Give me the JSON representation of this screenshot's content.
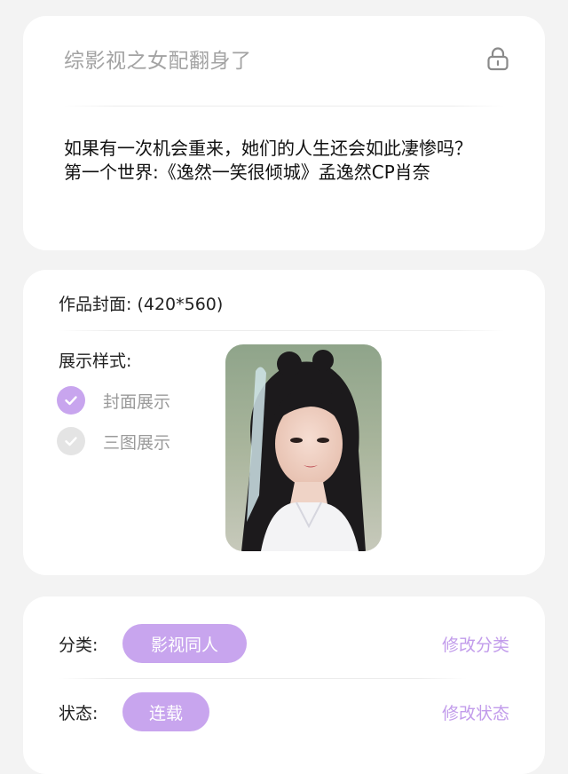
{
  "header": {
    "title": "综影视之女配翻身了"
  },
  "summary": {
    "text": "如果有一次机会重来，她们的人生还会如此凄惨吗？\n第一个世界:《逸然一笑很倾城》孟逸然CP肖奈"
  },
  "cover": {
    "label": "作品封面: (420*560)",
    "style_label": "展示样式:",
    "options": [
      {
        "label": "封面展示",
        "selected": true
      },
      {
        "label": "三图展示",
        "selected": false
      }
    ]
  },
  "meta": {
    "category_label": "分类:",
    "category_value": "影视同人",
    "category_action": "修改分类",
    "status_label": "状态:",
    "status_value": "连载",
    "status_action": "修改状态"
  },
  "colors": {
    "accent": "#c8a5ee",
    "accent_text": "#c29ceb",
    "background": "#f3f3f3"
  }
}
